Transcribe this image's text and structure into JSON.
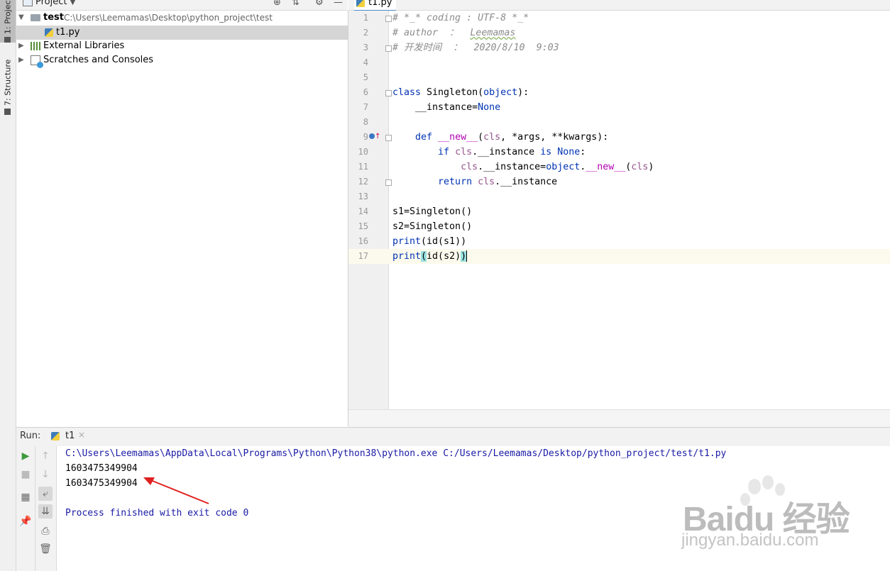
{
  "tool_strip": {
    "project_tab": "1: Project",
    "structure_tab": "7: Structure"
  },
  "project_panel": {
    "title": "Project",
    "tree": {
      "root_name": "test",
      "root_path": "C:\\Users\\Leemamas\\Desktop\\python_project\\test",
      "file": "t1.py",
      "external_libraries": "External Libraries",
      "scratches": "Scratches and Consoles"
    }
  },
  "editor": {
    "tab_label": "t1.py",
    "line_numbers": [
      "1",
      "2",
      "3",
      "4",
      "5",
      "6",
      "7",
      "8",
      "9",
      "10",
      "11",
      "12",
      "13",
      "14",
      "15",
      "16",
      "17"
    ],
    "code": {
      "l1": "# *_* coding : UTF-8 *_*",
      "l2_prefix": "# author  ：  ",
      "l2_name": "Leemamas",
      "l3": "# 开发时间  ：  2020/8/10  9:03",
      "l6_kw": "class",
      "l6_name": " Singleton(",
      "l6_base": "object",
      "l6_end": "):",
      "l7_var": "    __instance=",
      "l7_val": "None",
      "l9_kw": "    def",
      "l9_sp": " ",
      "l9_name": "__new__",
      "l9_open": "(",
      "l9_cls": "cls",
      "l9_rest": ", *args, **kwargs):",
      "l10_kw": "        if",
      "l10_sp": " ",
      "l10_cls": "cls",
      "l10_attr": ".__instance ",
      "l10_is": "is",
      "l10_sp2": " ",
      "l10_none": "None",
      "l10_end": ":",
      "l11_indent": "            ",
      "l11_cls": "cls",
      "l11_mid": ".__instance=",
      "l11_obj": "object",
      "l11_dot": ".",
      "l11_new": "__new__",
      "l11_open": "(",
      "l11_cls2": "cls",
      "l11_close": ")",
      "l12_kw": "        return",
      "l12_sp": " ",
      "l12_cls": "cls",
      "l12_attr": ".__instance",
      "l14": "s1=Singleton()",
      "l15": "s2=Singleton()",
      "l16_fn": "print",
      "l16_rest": "(id(s1))",
      "l17_fn": "print",
      "l17_open": "(",
      "l17_mid": "id(s2)",
      "l17_close": ")"
    }
  },
  "run_panel": {
    "label": "Run:",
    "tab": "t1",
    "close": "×",
    "console": {
      "command": "C:\\Users\\Leemamas\\AppData\\Local\\Programs\\Python\\Python38\\python.exe C:/Users/Leemamas/Desktop/python_project/test/t1.py",
      "out1": "1603475349904",
      "out2": "1603475349904",
      "exit": "Process finished with exit code 0"
    }
  },
  "watermark": {
    "brand": "Baidu 经验",
    "url": "jingyan.baidu.com"
  },
  "colors": {
    "keyword": "#0033b3",
    "dunder": "#b200b2",
    "self": "#94558d",
    "comment": "#8c8c8c",
    "console_blue": "#1a1aa6",
    "annotation_arrow": "#e02020"
  }
}
